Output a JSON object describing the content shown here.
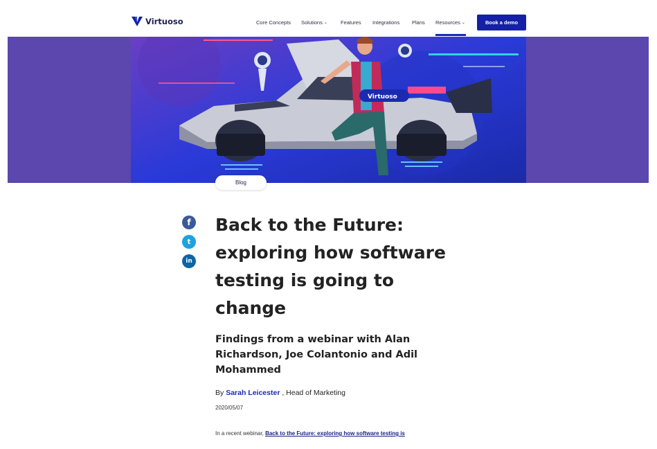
{
  "brand": {
    "name": "Virtuoso",
    "color": "#1b2350",
    "accent": "#1420a8"
  },
  "nav": {
    "items": [
      {
        "label": "Core Concepts",
        "dropdown": false
      },
      {
        "label": "Solutions",
        "dropdown": true
      },
      {
        "label": "Features",
        "dropdown": false
      },
      {
        "label": "Integrations",
        "dropdown": false
      },
      {
        "label": "Plans",
        "dropdown": false
      },
      {
        "label": "Resources",
        "dropdown": true,
        "active": true
      }
    ],
    "cta_label": "Book a demo"
  },
  "hero": {
    "badge_text": "Virtuoso",
    "band_color": "#5b47ae"
  },
  "category_pill": "Blog",
  "social": [
    {
      "network": "facebook",
      "icon": "facebook-icon",
      "glyph": "f",
      "color": "#3b5a9a"
    },
    {
      "network": "twitter",
      "icon": "twitter-icon",
      "glyph": "t",
      "color": "#1da1e2"
    },
    {
      "network": "linkedin",
      "icon": "linkedin-icon",
      "glyph": "in",
      "color": "#0a66a8"
    }
  ],
  "article": {
    "title_lines": [
      "Back to the Future:",
      "exploring how software",
      "testing is going to",
      "change"
    ],
    "subtitle_lines": [
      "Findings from a webinar with Alan",
      "Richardson, Joe Colantonio and Adil",
      "Mohammed"
    ],
    "by_prefix": "By",
    "author": "Sarah Leicester",
    "author_role": ", Head of Marketing",
    "date": "2020/05/07",
    "intro_prefix": "In a recent webinar,",
    "intro_link": "Back to the Future: exploring how software testing is"
  }
}
